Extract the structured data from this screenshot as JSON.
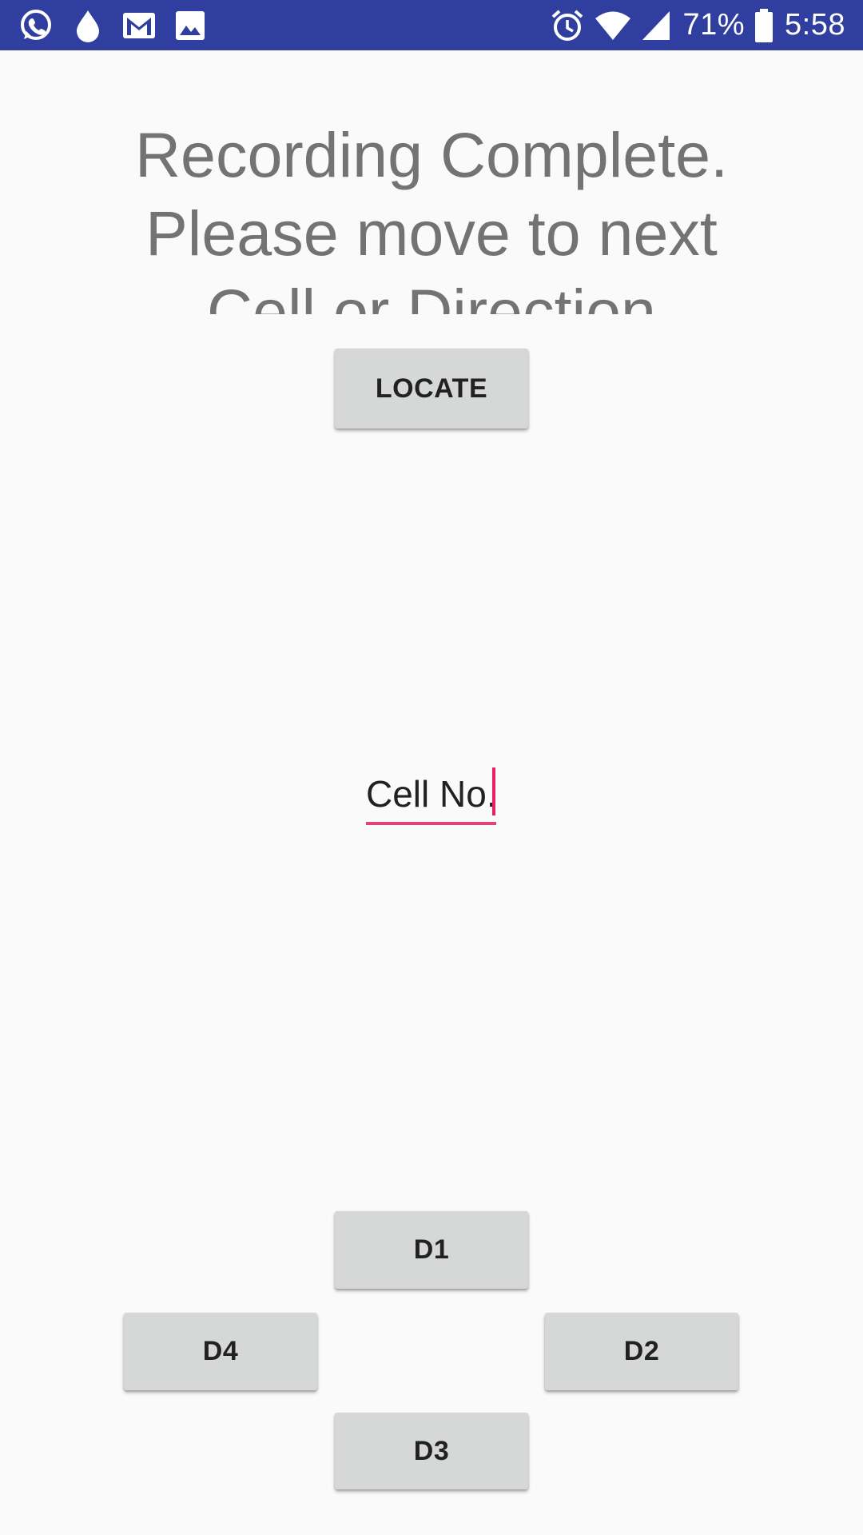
{
  "status_bar": {
    "battery_percent": "71%",
    "time": "5:58",
    "left_icons": [
      "whatsapp-icon",
      "drop-icon",
      "gmail-icon",
      "gallery-icon"
    ],
    "right_icons": [
      "alarm-icon",
      "wifi-icon",
      "signal-icon",
      "battery-icon"
    ],
    "background_color": "#303f9f"
  },
  "main": {
    "message": "Recording Complete.\nPlease move to next\nCell or Direction",
    "locate_button": "LOCATE",
    "cell_input": {
      "placeholder": "Cell No.",
      "value": ""
    },
    "accent_color": "#e91e63"
  },
  "direction_pad": {
    "d1": "D1",
    "d2": "D2",
    "d3": "D3",
    "d4": "D4"
  }
}
